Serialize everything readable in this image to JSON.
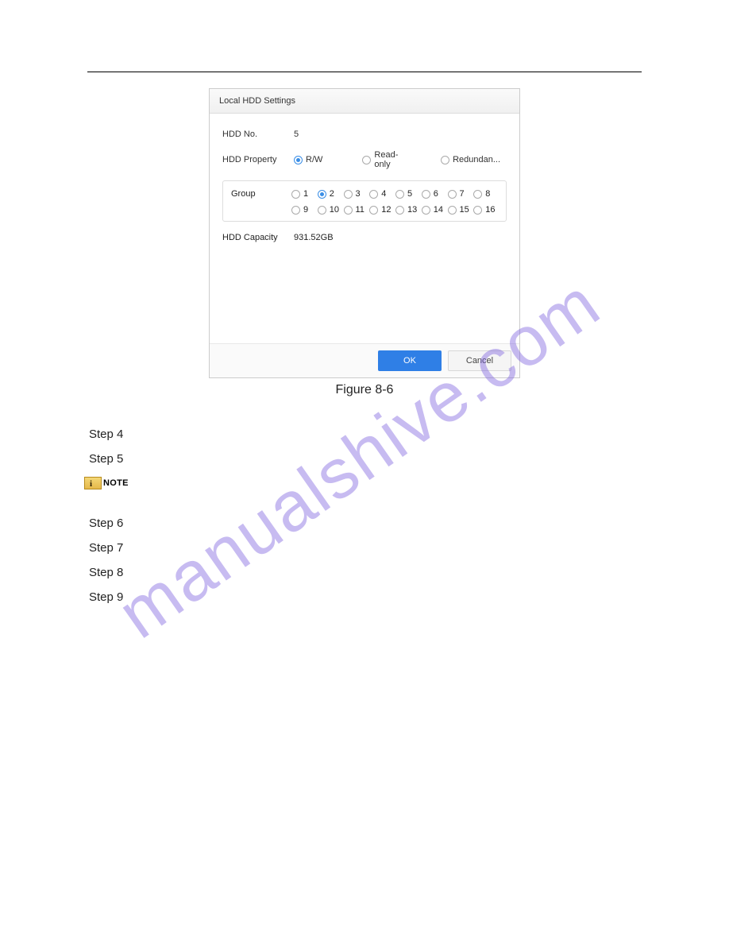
{
  "panel": {
    "title": "Local HDD Settings",
    "hdd_no_label": "HDD No.",
    "hdd_no_value": "5",
    "property_label": "HDD Property",
    "property_options": [
      {
        "label": "R/W",
        "selected": true
      },
      {
        "label": "Read-only",
        "selected": false
      },
      {
        "label": "Redundan...",
        "selected": false
      }
    ],
    "group_label": "Group",
    "group_options": [
      "1",
      "2",
      "3",
      "4",
      "5",
      "6",
      "7",
      "8",
      "9",
      "10",
      "11",
      "12",
      "13",
      "14",
      "15",
      "16"
    ],
    "group_selected_index": 1,
    "capacity_label": "HDD Capacity",
    "capacity_value": "931.52GB",
    "ok_label": "OK",
    "cancel_label": "Cancel"
  },
  "figure_caption": "Figure 8-6",
  "steps_a": [
    "Step 4",
    "Step 5"
  ],
  "note_label": "NOTE",
  "steps_b": [
    "Step 6",
    "Step 7",
    "Step 8",
    "Step 9"
  ],
  "watermark_text": "manualshive.com"
}
